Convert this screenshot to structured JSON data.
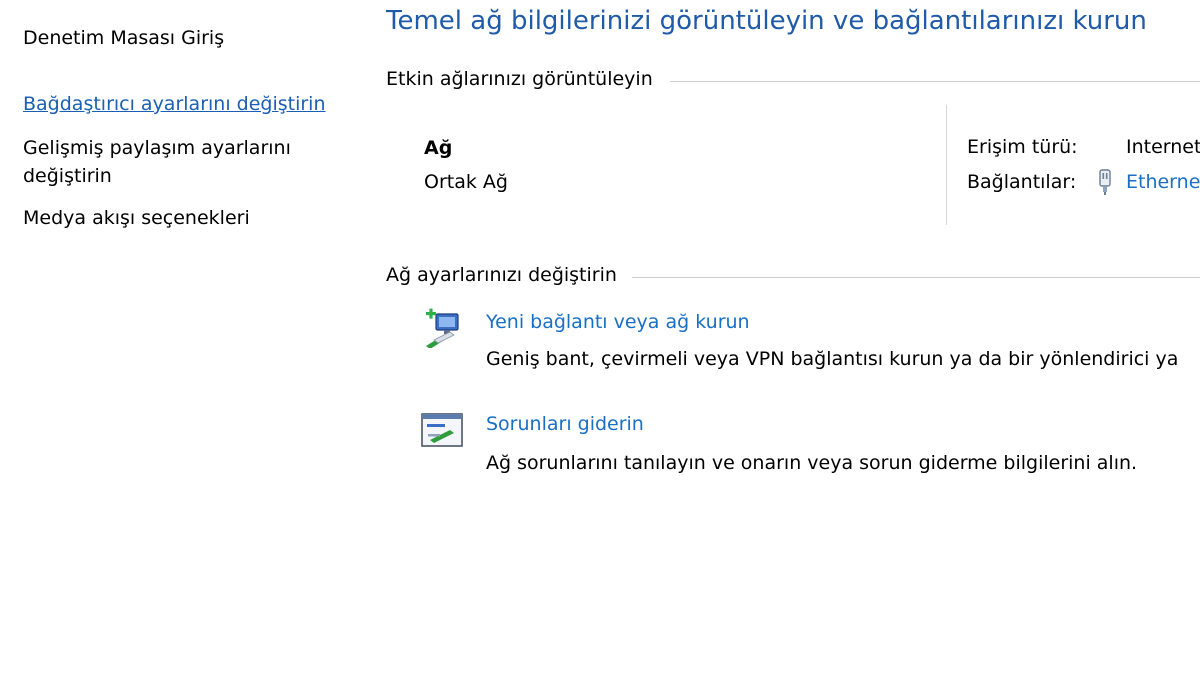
{
  "sidebar": {
    "home": "Denetim Masası Giriş",
    "adapter_settings": "Bağdaştırıcı ayarlarını değiştirin",
    "advanced_sharing_line1": "Gelişmiş paylaşım ayarlarını",
    "advanced_sharing_line2": "değiştirin",
    "media_streaming": "Medya akışı seçenekleri"
  },
  "main": {
    "title": "Temel ağ bilgilerinizi görüntüleyin ve bağlantılarınızı kurun",
    "active_networks": {
      "heading": "Etkin ağlarınızı görüntüleyin",
      "network_name": "Ağ",
      "network_category": "Ortak Ağ",
      "access_type_label": "Erişim türü:",
      "access_type_value": "Internet",
      "connections_label": "Bağlantılar:",
      "connections_value": "Ethernet"
    },
    "change_settings": {
      "heading": "Ağ ayarlarınızı değiştirin",
      "tasks": [
        {
          "icon": "new-connection-icon",
          "link": "Yeni bağlantı veya ağ kurun",
          "description": "Geniş bant, çevirmeli veya VPN bağlantısı kurun ya da bir yönlendirici ya"
        },
        {
          "icon": "troubleshoot-icon",
          "link": "Sorunları giderin",
          "description": "Ağ sorunlarını tanılayın ve onarın veya sorun giderme bilgilerini alın."
        }
      ]
    }
  },
  "colors": {
    "title_blue": "#1f5ba8",
    "link_blue": "#1a6fc4",
    "sidebar_link_blue": "#1a5fb4",
    "rule_gray": "#cfcfcf"
  }
}
